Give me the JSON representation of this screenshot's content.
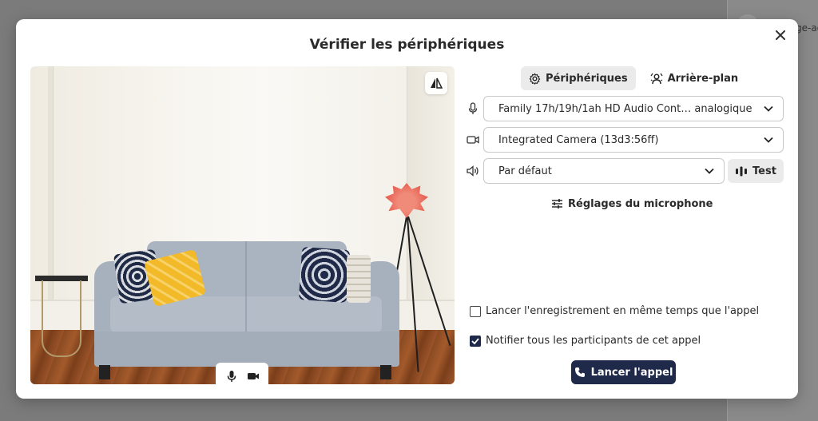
{
  "backdrop": {
    "partial_text": "ge-ac"
  },
  "modal": {
    "title": "Vérifier les périphériques",
    "close_icon": "close-icon"
  },
  "video": {
    "mirror_icon": "mirror-flip-icon",
    "toolbar": {
      "mic_icon": "microphone-icon",
      "camera_icon": "camera-icon"
    }
  },
  "tabs": [
    {
      "label": "Périphériques",
      "icon": "gear-icon",
      "active": true
    },
    {
      "label": "Arrière-plan",
      "icon": "background-person-icon",
      "active": false
    }
  ],
  "devices": {
    "microphone": {
      "icon": "microphone-icon",
      "value": "Family 17h/19h/1ah HD Audio Cont… analogique"
    },
    "camera": {
      "icon": "video-camera-icon",
      "value": "Integrated Camera (13d3:56ff)"
    },
    "speaker": {
      "icon": "speaker-icon",
      "value": "Par défaut",
      "test_label": "Test"
    }
  },
  "mic_settings": {
    "label": "Réglages du microphone",
    "icon": "sliders-icon"
  },
  "options": [
    {
      "label": "Lancer l'enregistrement en même temps que l'appel",
      "checked": false
    },
    {
      "label": "Notifier tous les participants de cet appel",
      "checked": true
    }
  ],
  "start_button": {
    "label": "Lancer l'appel",
    "icon": "phone-icon"
  },
  "colors": {
    "primary": "#1f2a4a",
    "tab_active_bg": "#ebebeb"
  }
}
